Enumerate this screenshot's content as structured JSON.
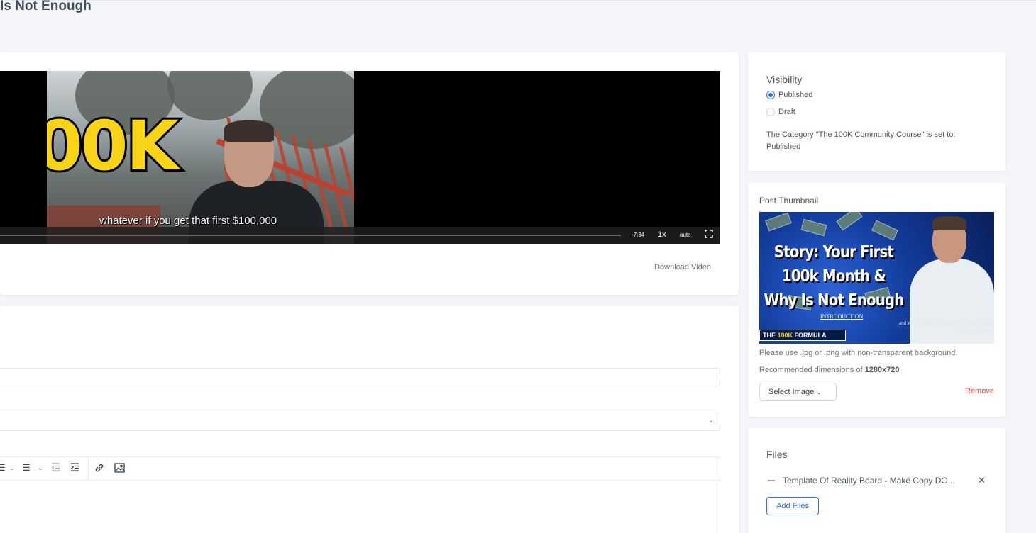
{
  "page": {
    "title": "Is Not Enough"
  },
  "video": {
    "overlay_text": "00K",
    "subtitle": "whatever if you get that first $100,000",
    "time_remaining": "-7:34",
    "speed": "1x",
    "quality": "auto",
    "progress": 0,
    "download_label": "Download Video"
  },
  "editor": {
    "toolbar_icons": [
      "bullet-list-icon",
      "numbered-list-icon",
      "outdent-icon",
      "indent-icon",
      "link-icon",
      "image-icon"
    ]
  },
  "visibility": {
    "title": "Visibility",
    "options": [
      {
        "label": "Published",
        "selected": true
      },
      {
        "label": "Draft",
        "selected": false
      }
    ],
    "note": "The Category \"The 100K Community Course\" is set to: Published"
  },
  "thumbnail": {
    "title": "Post Thumbnail",
    "image_headline": "Story: Your First 100k Month & Why Is Not Enough",
    "image_sub": "INTRODUCTION",
    "image_badge_pre": "THE ",
    "image_badge_yellow": "100K",
    "image_badge_post": " FORMULA",
    "image_caption": "and Why Is Only The Beginning Reality Vision Board Community",
    "hint_format": "Please use .jpg or .png with non-transparent background.",
    "hint_dims_prefix": "Recommended dimensions of ",
    "hint_dims_value": "1280x720",
    "select_label": "Select Image",
    "remove_label": "Remove"
  },
  "files": {
    "title": "Files",
    "items": [
      {
        "name": "Template Of Reality Board - Make Copy DO..."
      }
    ],
    "add_label": "Add Files"
  },
  "colors": {
    "accent": "#2f6fed",
    "danger": "#ef4444",
    "badge_yellow": "#f5d312"
  }
}
